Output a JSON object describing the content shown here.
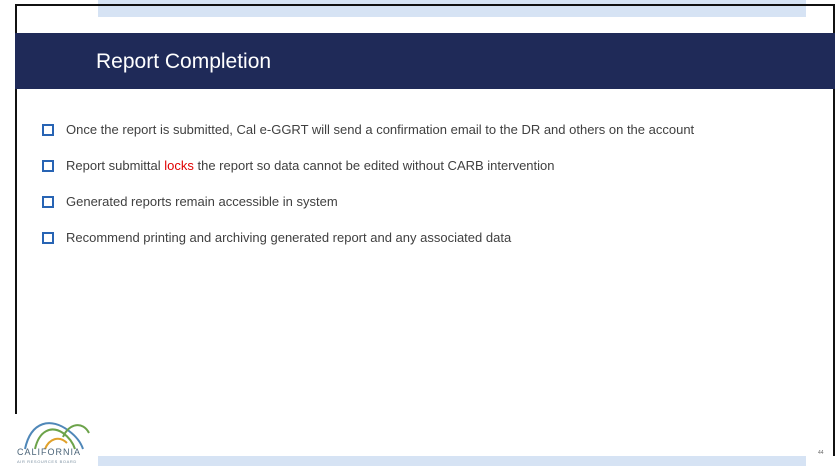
{
  "slide": {
    "title": "Report Completion",
    "page_number": "44"
  },
  "bullets": [
    {
      "text_before": "Once the report is submitted, Cal e-GGRT will send a confirmation email to the DR and others on the account",
      "highlight": "",
      "text_after": ""
    },
    {
      "text_before": "Report submittal ",
      "highlight": "locks",
      "text_after": " the report so data cannot be edited without CARB intervention"
    },
    {
      "text_before": "Generated reports remain accessible in system",
      "highlight": "",
      "text_after": ""
    },
    {
      "text_before": "Recommend printing and archiving generated report and any associated data",
      "highlight": "",
      "text_after": ""
    }
  ],
  "logo": {
    "word": "CALIFORNIA",
    "subtitle": "AIR RESOURCES BOARD"
  },
  "colors": {
    "title_band": "#1f2a58",
    "title_text": "#ffffff",
    "accent_blue": "#2864b4",
    "top_bar": "#d6e3f4",
    "highlight": "#e00000"
  }
}
